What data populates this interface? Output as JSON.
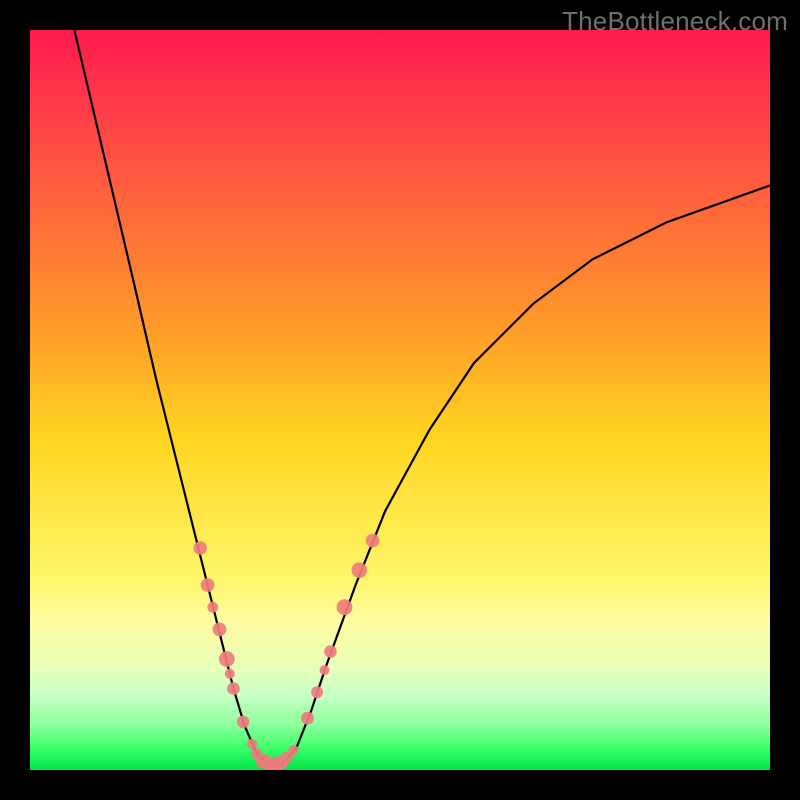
{
  "watermark": "TheBottleneck.com",
  "chart_data": {
    "type": "line",
    "title": "",
    "xlabel": "",
    "ylabel": "",
    "xlim": [
      0,
      100
    ],
    "ylim": [
      0,
      100
    ],
    "background_gradient": {
      "direction": "vertical",
      "stops": [
        {
          "pos": 0,
          "meaning": "worst",
          "color": "#ff1a4d"
        },
        {
          "pos": 55,
          "meaning": "mid",
          "color": "#ffd41f"
        },
        {
          "pos": 100,
          "meaning": "best",
          "color": "#00e64a"
        }
      ]
    },
    "curve": {
      "points": [
        {
          "x": 6,
          "y": 100
        },
        {
          "x": 10,
          "y": 83
        },
        {
          "x": 14,
          "y": 66
        },
        {
          "x": 17,
          "y": 53
        },
        {
          "x": 20,
          "y": 41
        },
        {
          "x": 22,
          "y": 33
        },
        {
          "x": 24,
          "y": 25
        },
        {
          "x": 26,
          "y": 17
        },
        {
          "x": 27.5,
          "y": 11
        },
        {
          "x": 29,
          "y": 6
        },
        {
          "x": 30.5,
          "y": 2.5
        },
        {
          "x": 32,
          "y": 0.7
        },
        {
          "x": 34,
          "y": 0.7
        },
        {
          "x": 36,
          "y": 3
        },
        {
          "x": 38,
          "y": 8
        },
        {
          "x": 40,
          "y": 14
        },
        {
          "x": 44,
          "y": 25
        },
        {
          "x": 48,
          "y": 35
        },
        {
          "x": 54,
          "y": 46
        },
        {
          "x": 60,
          "y": 55
        },
        {
          "x": 68,
          "y": 63
        },
        {
          "x": 76,
          "y": 69
        },
        {
          "x": 86,
          "y": 74
        },
        {
          "x": 100,
          "y": 79
        }
      ]
    },
    "markers": {
      "color": "#ef7c7c",
      "radius_range": [
        5,
        8
      ],
      "points": [
        {
          "x": 23.0,
          "y": 30
        },
        {
          "x": 24.0,
          "y": 25
        },
        {
          "x": 24.7,
          "y": 22
        },
        {
          "x": 25.6,
          "y": 19
        },
        {
          "x": 26.6,
          "y": 15
        },
        {
          "x": 27.0,
          "y": 13
        },
        {
          "x": 27.5,
          "y": 11
        },
        {
          "x": 28.8,
          "y": 6.5
        },
        {
          "x": 30.0,
          "y": 3.5
        },
        {
          "x": 30.6,
          "y": 2.2
        },
        {
          "x": 31.5,
          "y": 1.2
        },
        {
          "x": 32.3,
          "y": 0.8
        },
        {
          "x": 33.1,
          "y": 0.8
        },
        {
          "x": 33.9,
          "y": 1.0
        },
        {
          "x": 34.7,
          "y": 1.7
        },
        {
          "x": 35.6,
          "y": 2.7
        },
        {
          "x": 37.5,
          "y": 7.0
        },
        {
          "x": 38.8,
          "y": 10.5
        },
        {
          "x": 39.8,
          "y": 13.5
        },
        {
          "x": 40.6,
          "y": 16
        },
        {
          "x": 42.5,
          "y": 22
        },
        {
          "x": 44.5,
          "y": 27
        },
        {
          "x": 46.3,
          "y": 31
        }
      ]
    }
  }
}
